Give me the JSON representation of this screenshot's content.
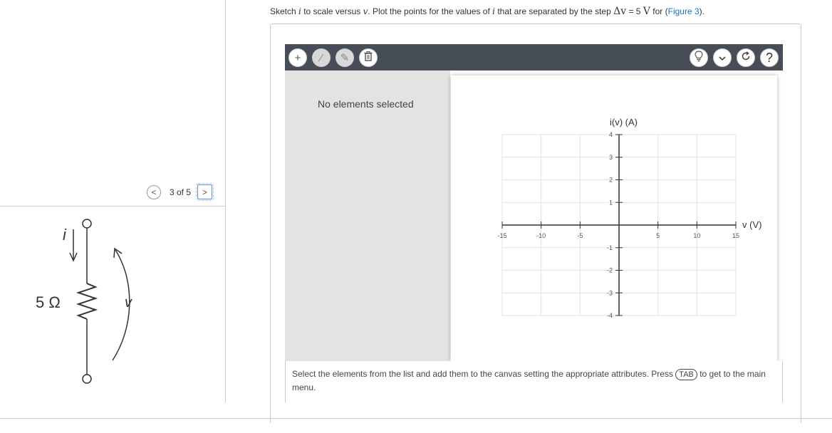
{
  "instruction": {
    "p1": "Sketch ",
    "var_i": "i",
    "p2": " to scale versus ",
    "var_v": "v",
    "p3": ". Plot the points for the values of ",
    "var_i2": "i",
    "p4": " that are separated by the step ",
    "step_expr": "Δv",
    "p5": " = 5 ",
    "unit": "V",
    "p6": " for (",
    "link": "Figure 3",
    "p7": ")."
  },
  "pager": {
    "text": "3 of 5",
    "prev": "<",
    "next": ">"
  },
  "circuit": {
    "current_label": "i",
    "resistor_label": "5 Ω",
    "voltage_label": "v"
  },
  "toolbar": {
    "add": "+",
    "line": "⁄",
    "draw": "✎",
    "delete": "🗑",
    "hint": "💡",
    "more": "⌄",
    "reset": "↻",
    "help": "?"
  },
  "sidebar": {
    "empty_text": "No elements selected"
  },
  "graph": {
    "ylabel": "i(v) (A)",
    "xlabel": "v (V)",
    "xticks": [
      "-15",
      "-10",
      "-5",
      "5",
      "10",
      "15"
    ],
    "yticks": [
      "4",
      "3",
      "2",
      "1",
      "-1",
      "-2",
      "-3",
      "-4"
    ]
  },
  "chart_data": {
    "type": "scatter",
    "title": "",
    "xlabel": "v (V)",
    "ylabel": "i(v) (A)",
    "xlim": [
      -15,
      15
    ],
    "ylim": [
      -4,
      4
    ],
    "xtick_values": [
      -15,
      -10,
      -5,
      5,
      10,
      15
    ],
    "ytick_values": [
      4,
      3,
      2,
      1,
      -1,
      -2,
      -3,
      -4
    ],
    "grid": true,
    "series": []
  },
  "hint": {
    "p1": "Select the elements from the list and add them to the canvas setting the appropriate attributes. Press ",
    "key": "TAB",
    "p2": " to get to the main menu."
  }
}
